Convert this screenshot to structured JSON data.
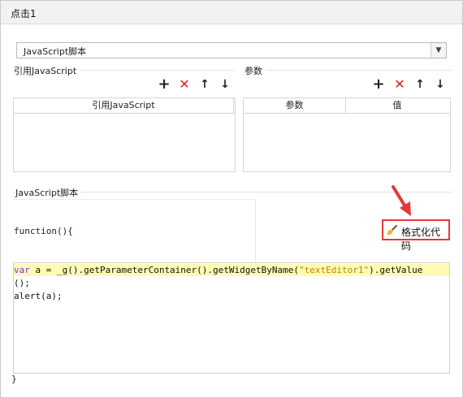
{
  "window": {
    "title": "点击1"
  },
  "script_type": {
    "selected": "JavaScript脚本"
  },
  "ref_js": {
    "group_label": "引用JavaScript",
    "columns": [
      "引用JavaScript"
    ]
  },
  "params": {
    "group_label": "参数",
    "columns": [
      "参数",
      "值"
    ]
  },
  "toolbar": {
    "add": "+",
    "delete": "✕",
    "up": "↑",
    "down": "↓"
  },
  "script_editor": {
    "group_label": "JavaScript脚本",
    "function_header": "function(){",
    "format_button": "格式化代码",
    "code_line1_kw": "var",
    "code_line1_a": " a = _g().getParameterContainer().getWidgetByName(",
    "code_line1_str": "\"textEditor1\"",
    "code_line1_b": ").getValue",
    "code_line2": "();",
    "code_line3": "alert(a);",
    "closing_brace": "}"
  },
  "colors": {
    "highlight": "#fffbb3",
    "annotation_red": "#e53935"
  }
}
